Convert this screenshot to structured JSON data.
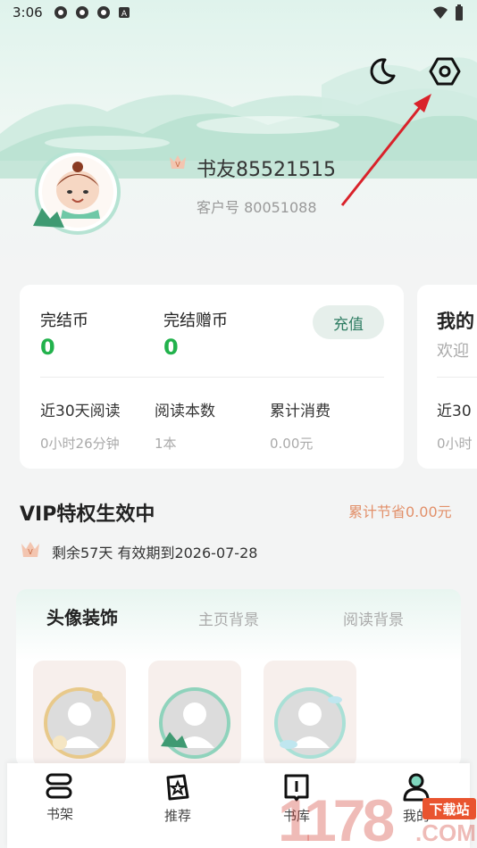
{
  "status_bar": {
    "time": "3:06"
  },
  "header": {
    "nickname": "书友85521515",
    "customer_no": "客户号 80051088",
    "night_mode_icon": "moon-icon",
    "settings_icon": "hexagon-settings-icon"
  },
  "wallet_card": {
    "coin_label": "完结币",
    "coin_value": "0",
    "gift_coin_label": "完结赠币",
    "gift_coin_value": "0",
    "recharge_label": "充值",
    "read_30_label": "近30天阅读",
    "read_30_value": "0小时26分钟",
    "books_label": "阅读本数",
    "books_value": "1本",
    "spent_label": "累计消费",
    "spent_value": "0.00元"
  },
  "side_card": {
    "title": "我的",
    "subtitle": "欢迎",
    "read_label": "近30",
    "read_value": "0小时"
  },
  "vip": {
    "title": "VIP特权生效中",
    "saved": "累计节省0.00元",
    "remaining": "剩余57天  有效期到2026-07-28"
  },
  "decor": {
    "tabs": [
      "头像装饰",
      "主页背景",
      "阅读背景"
    ]
  },
  "bottom_nav": [
    {
      "label": "书架",
      "icon": "bookshelf-icon"
    },
    {
      "label": "推荐",
      "icon": "star-book-icon"
    },
    {
      "label": "书库",
      "icon": "library-icon"
    },
    {
      "label": "我的",
      "icon": "person-icon"
    }
  ],
  "watermark": {
    "text": "下载站",
    "brand": "1178",
    "suffix": ".COM"
  },
  "colors": {
    "accent_green": "#22b24c",
    "vip_orange": "#e2906a",
    "recharge_bg": "#e6efeb"
  }
}
